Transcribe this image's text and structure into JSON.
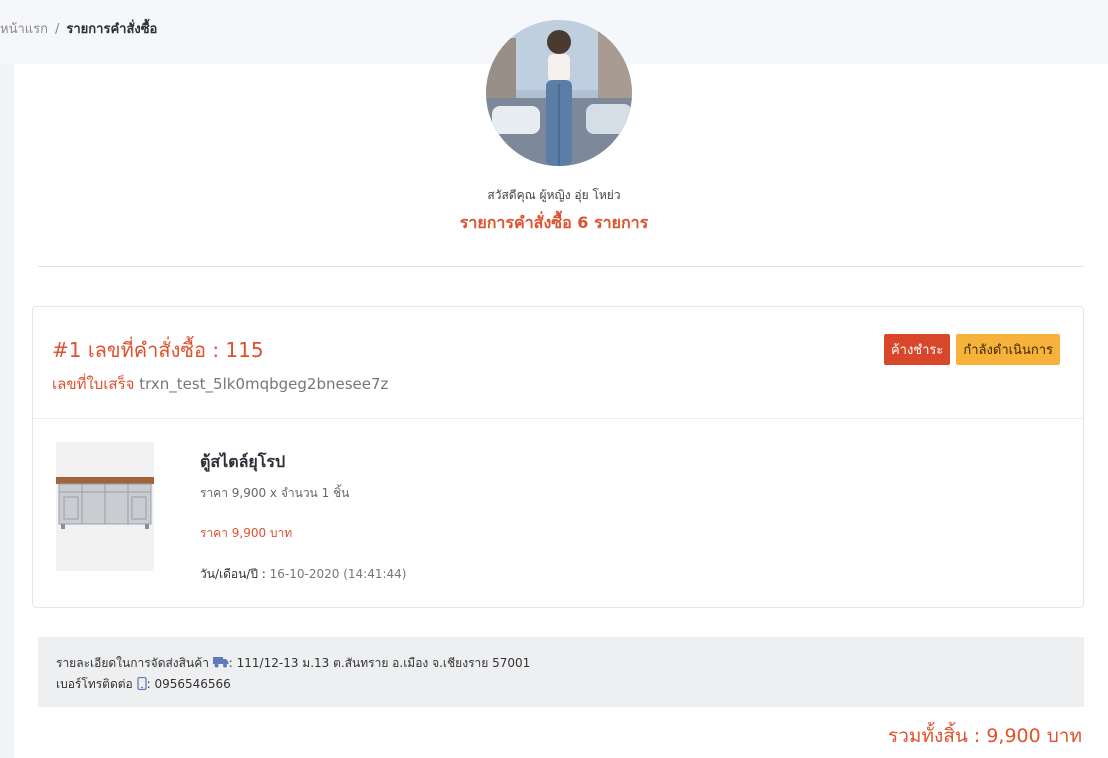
{
  "breadcrumb": {
    "home": "หน้าแรก",
    "separator": "/",
    "current": "รายการคำสั่งซื้อ"
  },
  "profile": {
    "greeting": "สวัสดีคุณ ผู้หญิง อุ่ย โหย่ว",
    "order_count": "รายการคำสั่งซื้อ 6 รายการ"
  },
  "order": {
    "title": "#1 เลขที่คำสั่งซื้อ : 115",
    "receipt_label": "เลขที่ใบเสร็จ",
    "receipt_value": "trxn_test_5lk0mqbgeg2bnesee7z",
    "badge_unpaid": "ค้างชำระ",
    "badge_status": "กำลังดำเนินการ",
    "item": {
      "name": "ตู้สไตล์ยุโรป",
      "price_qty": "ราคา 9,900 x จำนวน 1 ชิ้น",
      "price_total": "ราคา 9,900 บาท",
      "date_label": "วัน/เดือน/ปี :",
      "date_value": "16-10-2020 (14:41:44)"
    }
  },
  "shipping": {
    "address_label": "รายละเอียดในการจัดส่งสินค้า",
    "address_value": ": 111/12-13 ม.13 ต.สันทราย อ.เมือง จ.เชียงราย 57001",
    "phone_label": "เบอร์โทรติดต่อ",
    "phone_value": ": 0956546566"
  },
  "grand_total": "รวมทั้งสิ้น : 9,900 บาท",
  "colors": {
    "accent": "#e0512e",
    "badge_unpaid": "#d9472b",
    "badge_status": "#f7b23b"
  },
  "icons": {
    "shipping": "truck-icon",
    "phone": "phone-icon"
  }
}
